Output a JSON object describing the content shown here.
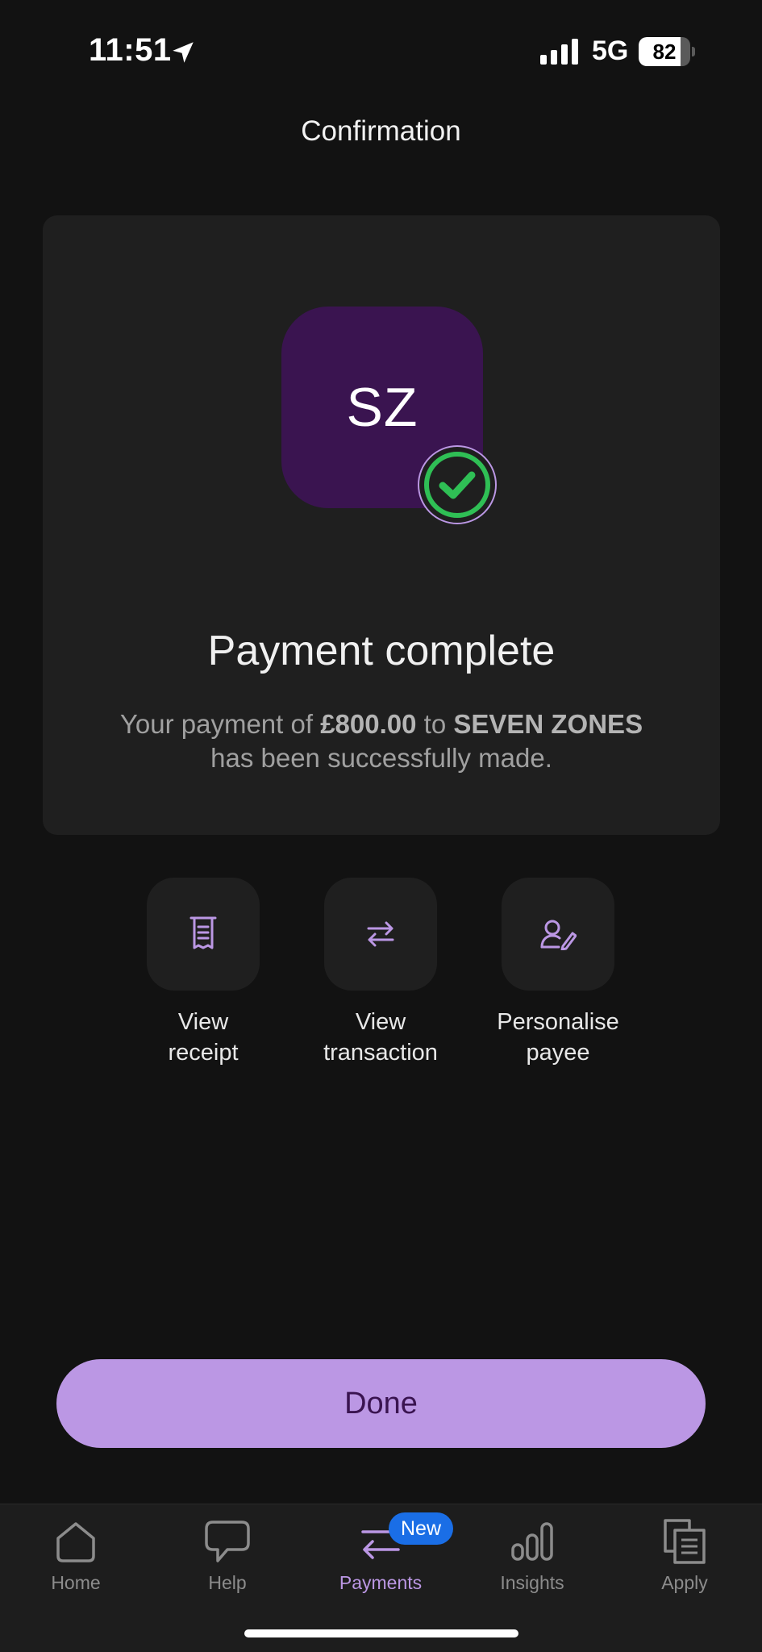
{
  "status_bar": {
    "time": "11:51",
    "network": "5G",
    "battery_percent": "82",
    "battery_level": 0.82
  },
  "header": {
    "title": "Confirmation"
  },
  "confirmation": {
    "avatar_initials": "SZ",
    "heading": "Payment complete",
    "message_prefix": "Your payment of",
    "amount": "£800.00",
    "message_to": "to",
    "payee": "SEVEN ZONES",
    "message_suffix": "has been successfully made."
  },
  "actions": [
    {
      "label": "View\nreceipt",
      "icon": "receipt-icon"
    },
    {
      "label": "View\ntransaction",
      "icon": "transfer-arrows-icon"
    },
    {
      "label": "Personalise\npayee",
      "icon": "user-edit-icon"
    }
  ],
  "done_label": "Done",
  "tab_bar": {
    "tabs": [
      {
        "label": "Home",
        "icon": "home-icon"
      },
      {
        "label": "Help",
        "icon": "chat-bubble-icon"
      },
      {
        "label": "Payments",
        "icon": "payments-arrows-icon",
        "active": true
      },
      {
        "label": "Insights",
        "icon": "bar-chart-icon"
      },
      {
        "label": "Apply",
        "icon": "documents-icon"
      }
    ],
    "payments_badge": "New"
  },
  "colors": {
    "background": "#121212",
    "card": "#1f1f1f",
    "accent": "#bb97e4",
    "avatar": "#3a1450",
    "success": "#2fbf55",
    "badge": "#1a6ee6"
  }
}
